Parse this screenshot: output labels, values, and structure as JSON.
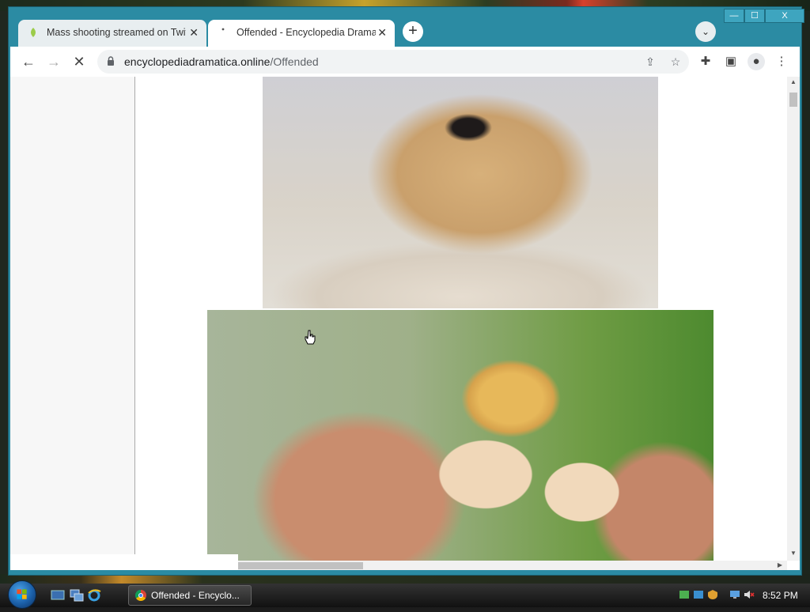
{
  "window": {
    "controls": {
      "minimize": "—",
      "maximize": "☐",
      "close": "X"
    }
  },
  "tabs": [
    {
      "title": "Mass shooting streamed on Twitch",
      "active": false
    },
    {
      "title": "Offended - Encyclopedia Dramatica",
      "active": true
    }
  ],
  "toolbar": {
    "url_host": "encyclopediadramatica.online",
    "url_path": "/Offended",
    "new_tab": "+"
  },
  "taskbar": {
    "window_button": "Offended - Encyclo...",
    "clock": "8:52 PM"
  },
  "colors": {
    "titlebar": "#2b8ba3",
    "tab_inactive": "#e8eef0",
    "omnibox": "#f1f3f4"
  },
  "icons": {
    "back": "arrow-left-icon",
    "forward": "arrow-right-icon",
    "stop": "close-icon",
    "lock": "lock-icon",
    "share": "share-icon",
    "bookmark": "star-icon",
    "extensions": "puzzle-icon",
    "side_panel": "side-panel-icon",
    "profile": "profile-icon",
    "menu": "kebab-menu-icon"
  }
}
